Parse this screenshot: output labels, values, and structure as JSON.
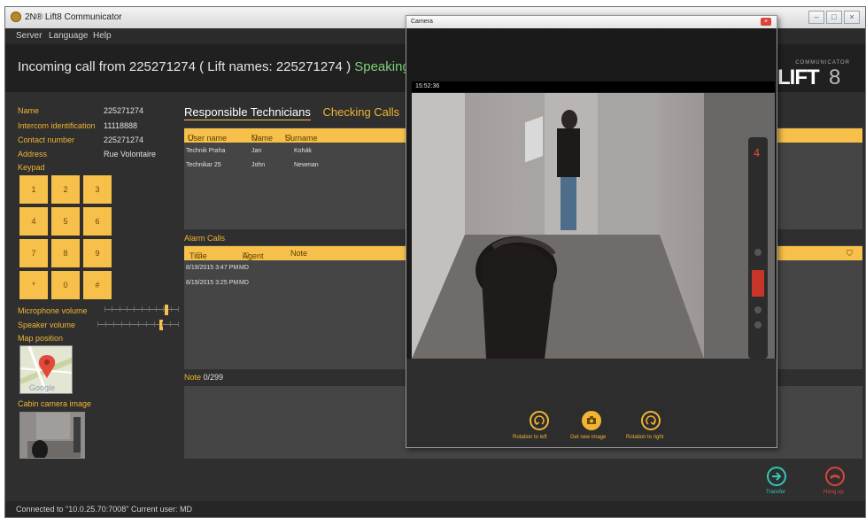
{
  "app": {
    "title": "2N® Lift8 Communicator"
  },
  "menu": [
    "Server",
    "Language",
    "Help"
  ],
  "header": {
    "call_text": "Incoming call from  225271274  ( Lift names: 225271274 )",
    "status": "Speaking...",
    "brand_small": "COMMUNICATOR",
    "brand_big": "LIFT",
    "brand_num": "8"
  },
  "info": {
    "name_label": "Name",
    "name_value": "225271274",
    "intercom_label": "Intercom identification",
    "intercom_value": "11118888",
    "contact_label": "Contact number",
    "contact_value": "225271274",
    "address_label": "Address",
    "address_value": "Rue Volontaire",
    "keypad_label": "Keypad"
  },
  "keypad": [
    "1",
    "2",
    "3",
    "4",
    "5",
    "6",
    "7",
    "8",
    "9",
    "*",
    "0",
    "#"
  ],
  "volume": {
    "mic_label": "Microphone volume",
    "speaker_label": "Speaker volume",
    "mic_level": 0.85,
    "speaker_level": 0.8
  },
  "map": {
    "label": "Map position",
    "google": "Google"
  },
  "cabin": {
    "label": "Cabin camera image"
  },
  "tabs": {
    "active": "Responsible Technicians",
    "inactive": "Checking Calls"
  },
  "technicians": {
    "columns": [
      "User name",
      "Name",
      "Surname"
    ],
    "rows": [
      [
        "Technik Praha",
        "Jan",
        "Kohák"
      ],
      [
        "Technikar 25",
        "John",
        "Newman"
      ]
    ]
  },
  "alarms": {
    "label": "Alarm Calls",
    "columns": [
      "Time",
      "Agent",
      "Note"
    ],
    "rows": [
      [
        "8/19/2015 3:47 PM",
        "MD"
      ],
      [
        "8/19/2015 3:25 PM",
        "MD"
      ]
    ]
  },
  "note": {
    "label": "Note",
    "count": "0/299"
  },
  "actions": {
    "transfer": "Transfer",
    "hangup": "Hang up"
  },
  "status_bar": "Connected to \"10.0.25.70:7008\"   Current user: MD",
  "camera": {
    "title": "Camera",
    "timestamp": "15:52:36",
    "floor": "4",
    "rotate_left": "Rotation to left",
    "get_image": "Get new image",
    "rotate_right": "Rotation to right"
  },
  "colors": {
    "accent": "#f6c04a",
    "panel": "#454545",
    "background": "#2f2f2f",
    "speaking": "#7fd07a",
    "hangup": "#d9453a",
    "transfer": "#2fc9b8"
  }
}
